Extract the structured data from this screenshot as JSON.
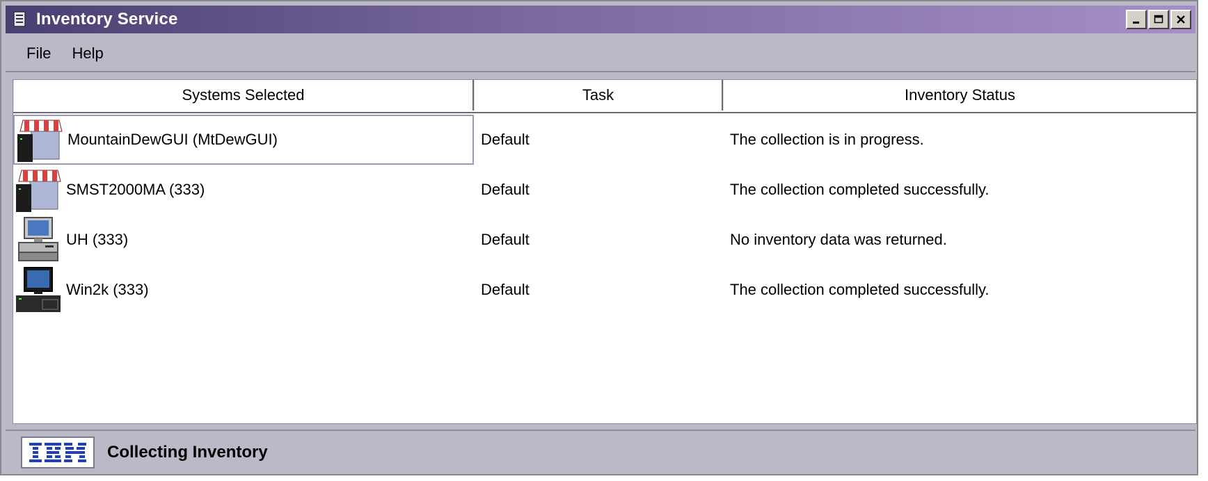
{
  "window": {
    "title": "Inventory Service",
    "controls": [
      "minimize",
      "maximize",
      "close"
    ]
  },
  "menu": {
    "items": [
      {
        "label": "File"
      },
      {
        "label": "Help"
      }
    ]
  },
  "table": {
    "columns": [
      "Systems Selected",
      "Task",
      "Inventory Status"
    ],
    "rows": [
      {
        "system": "MountainDewGUI (MtDewGUI)",
        "icon": "store-server-icon",
        "task": "Default",
        "status": "The collection is in progress.",
        "selected": true
      },
      {
        "system": "SMST2000MA (333)",
        "icon": "store-server-icon",
        "task": "Default",
        "status": "The collection completed successfully.",
        "selected": false
      },
      {
        "system": "UH (333)",
        "icon": "desktop-computer-icon",
        "task": "Default",
        "status": "No inventory data was returned.",
        "selected": false
      },
      {
        "system": "Win2k (333)",
        "icon": "desktop-computer-icon",
        "task": "Default",
        "status": "The collection completed successfully.",
        "selected": false
      }
    ]
  },
  "statusbar": {
    "logo": "IBM",
    "text": "Collecting Inventory"
  },
  "colors": {
    "title_gradient_start": "#4a3f72",
    "title_gradient_end": "#a58fc6",
    "chrome": "#b9b9c8",
    "logo_blue": "#1f3fbf"
  }
}
